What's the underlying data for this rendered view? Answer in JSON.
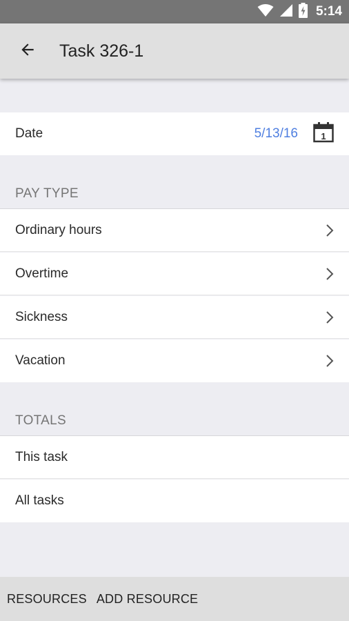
{
  "status_bar": {
    "time": "5:14",
    "icons": [
      "wifi-icon",
      "cell-signal-icon",
      "battery-charging-icon"
    ]
  },
  "app_bar": {
    "back_icon": "arrow-left-icon",
    "title": "Task 326-1"
  },
  "date_row": {
    "label": "Date",
    "value": "5/13/16",
    "calendar_icon": "calendar-icon",
    "calendar_day": "1",
    "value_color": "#4f7fe0"
  },
  "pay_type": {
    "header": "PAY TYPE",
    "items": [
      {
        "label": "Ordinary hours"
      },
      {
        "label": "Overtime"
      },
      {
        "label": "Sickness"
      },
      {
        "label": "Vacation"
      }
    ]
  },
  "totals": {
    "header": "TOTALS",
    "items": [
      {
        "label": "This task"
      },
      {
        "label": "All tasks"
      }
    ]
  },
  "bottom_bar": {
    "resources_label": "RESOURCES",
    "add_resource_label": "ADD RESOURCE"
  }
}
